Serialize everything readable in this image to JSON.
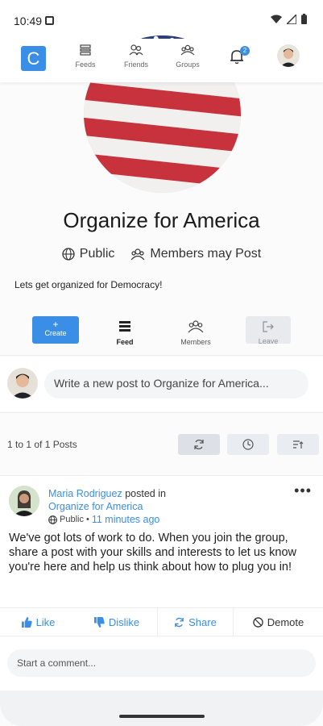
{
  "status": {
    "time": "10:49"
  },
  "nav": {
    "logo": "C",
    "items": [
      {
        "label": "Feeds",
        "icon": "feed-icon"
      },
      {
        "label": "Friends",
        "icon": "friends-icon"
      },
      {
        "label": "Groups",
        "icon": "groups-icon"
      }
    ],
    "notifications_count": "2"
  },
  "group": {
    "title": "Organize for America",
    "visibility": "Public",
    "posting": "Members may Post",
    "description": "Lets get organized for Democracy!"
  },
  "actions": {
    "create": "Create",
    "create_symbol": "+",
    "feed": "Feed",
    "members": "Members",
    "leave": "Leave"
  },
  "composer": {
    "placeholder": "Write a new post to Organize for America..."
  },
  "posts_summary": "1 to 1 of 1 Posts",
  "post": {
    "author": "Maria Rodriguez",
    "posted_in": "posted in",
    "group": "Organize for America",
    "visibility": "Public",
    "separator": "•",
    "time": "11 minutes ago",
    "more": "•••",
    "body": "We've got lots of work to do. When you join the group, share a post with your skills and interests to let us know you're here and help us think about how to plug you in!",
    "like": "Like",
    "dislike": "Dislike",
    "share": "Share",
    "demote": "Demote",
    "comment_placeholder": "Start a comment..."
  },
  "colors": {
    "accent": "#3a8ee6",
    "flag_red": "#c8323c",
    "flag_blue": "#2d3e78"
  }
}
